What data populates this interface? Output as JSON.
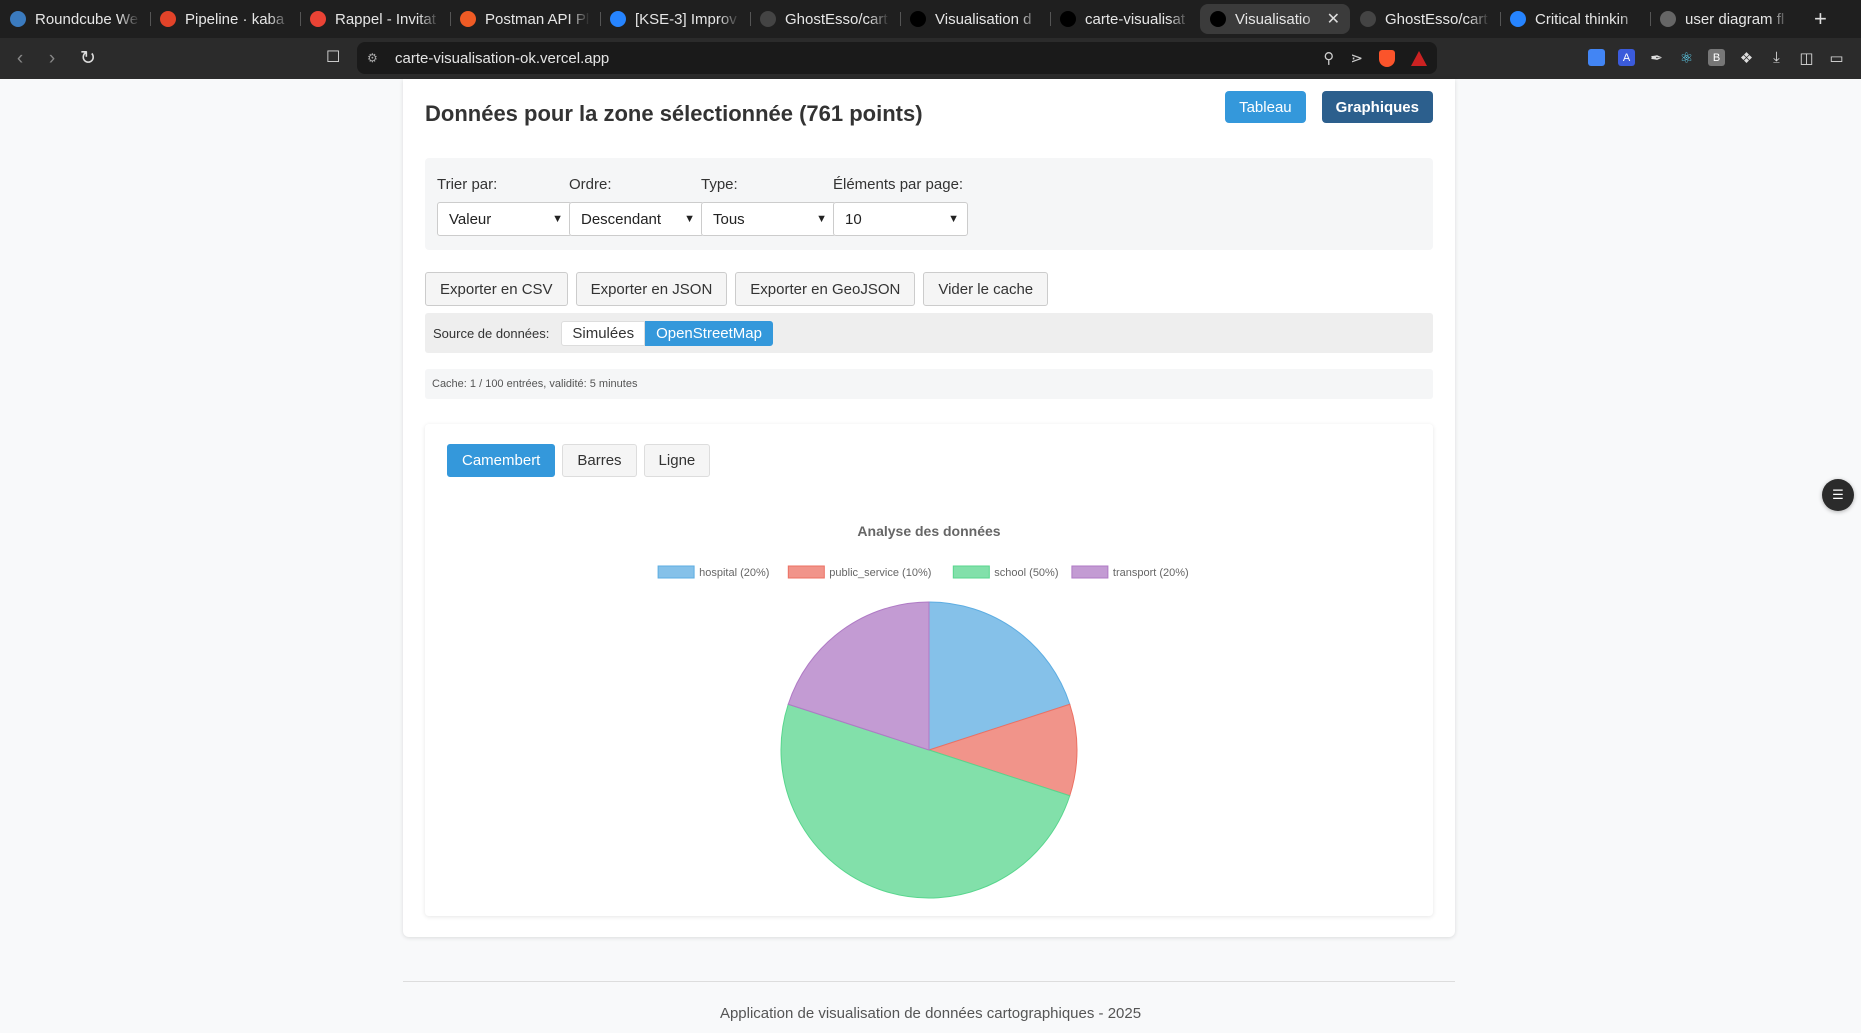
{
  "browser": {
    "tabs": [
      {
        "title": "Roundcube We",
        "icon": "roundcube-icon",
        "color": "#3b7bbf"
      },
      {
        "title": "Pipeline · kaba",
        "icon": "gitlab-icon",
        "color": "#e24329"
      },
      {
        "title": "Rappel - Invitat",
        "icon": "gmail-icon",
        "color": "#ea4335"
      },
      {
        "title": "Postman API Pl",
        "icon": "postman-icon",
        "color": "#ef5b25"
      },
      {
        "title": "[KSE-3] Improv",
        "icon": "jira-icon",
        "color": "#2684ff"
      },
      {
        "title": "GhostEsso/cart",
        "icon": "github-icon",
        "color": "#444444"
      },
      {
        "title": "Visualisation d",
        "icon": "vercel-icon",
        "color": "#000000"
      },
      {
        "title": "carte-visualisat",
        "icon": "vercel-icon",
        "color": "#000000"
      },
      {
        "title": "Visualisatio",
        "icon": "vercel-icon",
        "color": "#000000",
        "active": true
      },
      {
        "title": "GhostEsso/cart",
        "icon": "github-icon",
        "color": "#444444"
      },
      {
        "title": "Critical thinkin",
        "icon": "confluence-icon",
        "color": "#2684ff"
      },
      {
        "title": "user diagram fl",
        "icon": "globe-icon",
        "color": "#666666"
      }
    ],
    "url": "carte-visualisation-ok.vercel.app"
  },
  "header": {
    "title": "Données pour la zone sélectionnée (761 points)",
    "tableau_label": "Tableau",
    "graphiques_label": "Graphiques"
  },
  "filters": {
    "sort_label": "Trier par:",
    "sort_value": "Valeur",
    "order_label": "Ordre:",
    "order_value": "Descendant",
    "type_label": "Type:",
    "type_value": "Tous",
    "per_page_label": "Éléments par page:",
    "per_page_value": "10"
  },
  "actions": {
    "csv": "Exporter en CSV",
    "json": "Exporter en JSON",
    "geojson": "Exporter en GeoJSON",
    "clear_cache": "Vider le cache"
  },
  "source": {
    "label": "Source de données:",
    "simulated": "Simulées",
    "osm": "OpenStreetMap",
    "active": "OpenStreetMap"
  },
  "cache_info": "Cache: 1 / 100 entrées, validité: 5 minutes",
  "chart_tabs": {
    "pie": "Camembert",
    "bar": "Barres",
    "line": "Ligne",
    "active": "Camembert"
  },
  "chart_data": {
    "type": "pie",
    "title": "Analyse des données",
    "categories": [
      "hospital",
      "public_service",
      "school",
      "transport"
    ],
    "values": [
      20,
      10,
      50,
      20
    ],
    "legend_labels": [
      "hospital (20%)",
      "public_service (10%)",
      "school (50%)",
      "transport (20%)"
    ],
    "colors": [
      "#85c1e9",
      "#f1948a",
      "#82e0aa",
      "#c39bd3"
    ],
    "border_colors": [
      "#5dade2",
      "#ec7063",
      "#58d68d",
      "#af7ac5"
    ],
    "legend_position": "top"
  },
  "footer": "Application de visualisation de données cartographiques - 2025"
}
